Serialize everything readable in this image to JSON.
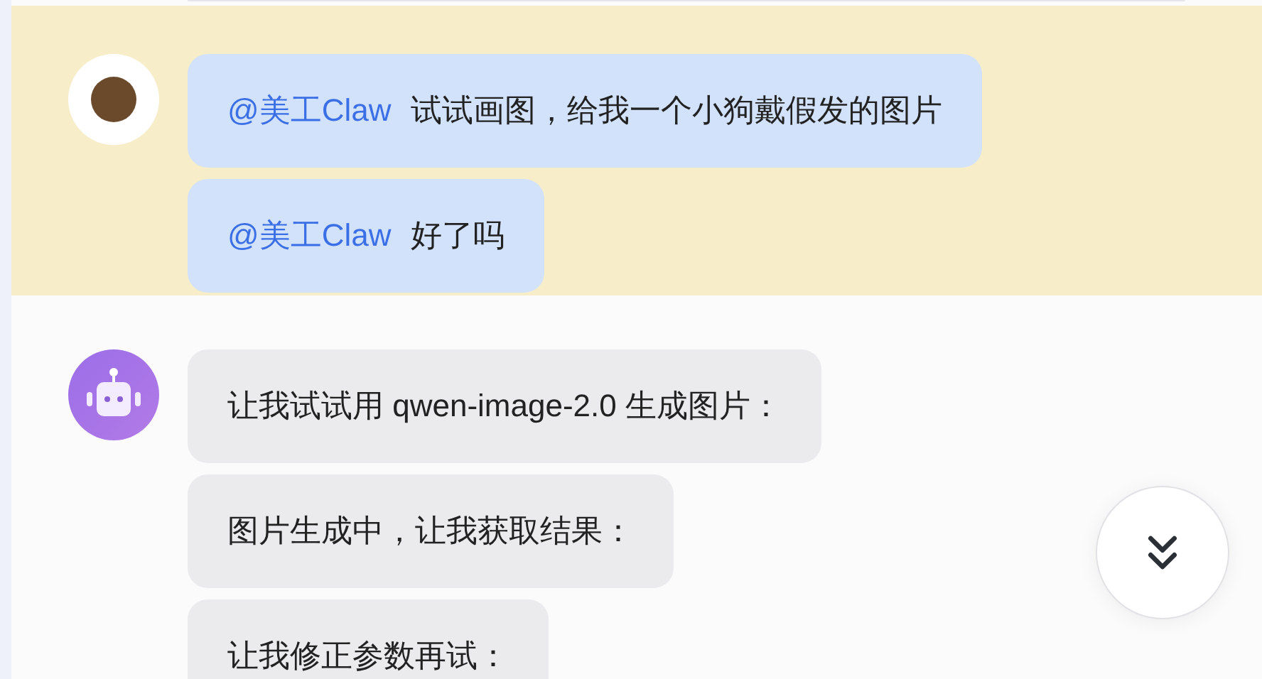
{
  "groups": [
    {
      "kind": "user",
      "highlighted": true,
      "messages": [
        {
          "mention": "@美工Claw",
          "text": "试试画图，给我一个小狗戴假发的图片"
        },
        {
          "mention": "@美工Claw",
          "text": "好了吗"
        }
      ]
    },
    {
      "kind": "bot",
      "highlighted": false,
      "messages": [
        {
          "text": "让我试试用 qwen-image-2.0 生成图片："
        },
        {
          "text": "图片生成中，让我获取结果："
        },
        {
          "text": "让我修正参数再试："
        }
      ]
    }
  ]
}
